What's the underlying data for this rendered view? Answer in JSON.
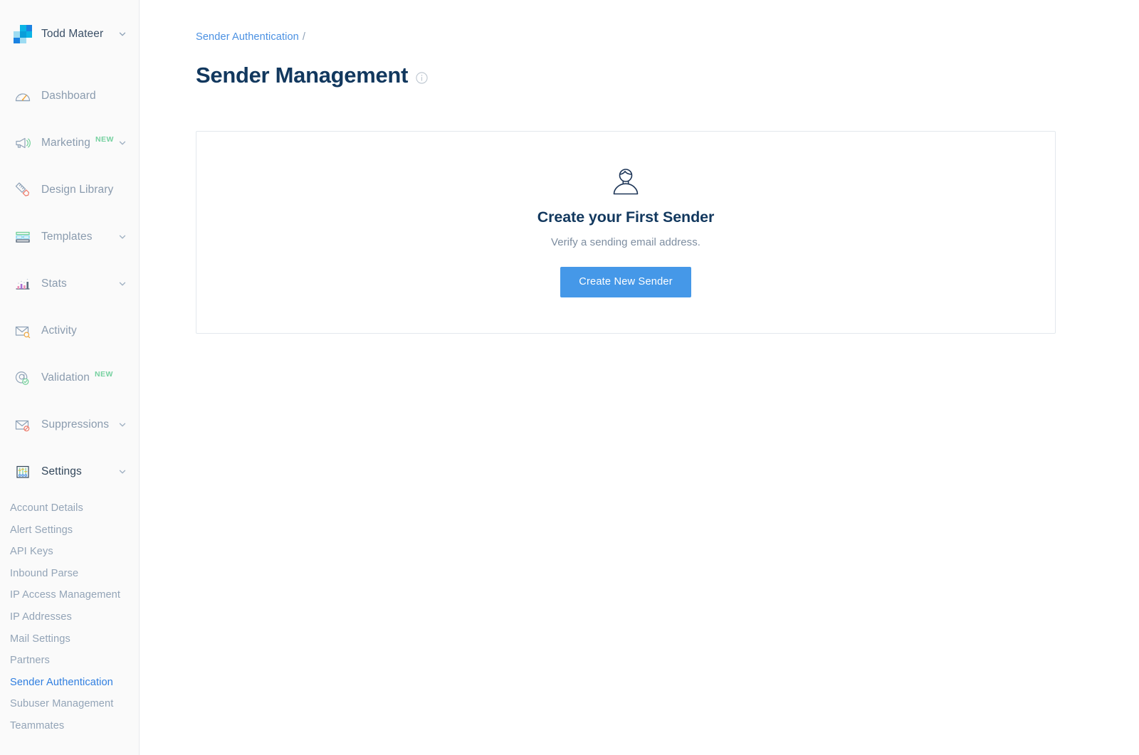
{
  "colors": {
    "accent_blue": "#4598e8",
    "link_blue": "#4a90e2",
    "active_link_blue": "#2f7ee0",
    "title_navy": "#12385e",
    "muted_text": "#8a9bae",
    "badge_green": "#76d1a0",
    "sidebar_bg": "#fafafa",
    "card_border": "#e3e8ed"
  },
  "sidebar": {
    "account": {
      "name": "Todd Mateer",
      "logo_icon": "sendgrid-logo-icon",
      "caret_icon": "chevron-down-icon"
    },
    "items": [
      {
        "label": "Dashboard",
        "icon": "speedometer-icon",
        "badge": "",
        "caret": false,
        "active": false
      },
      {
        "label": "Marketing",
        "icon": "megaphone-icon",
        "badge": "NEW",
        "caret": true,
        "active": false
      },
      {
        "label": "Design Library",
        "icon": "ruler-pencil-icon",
        "badge": "",
        "caret": false,
        "active": false
      },
      {
        "label": "Templates",
        "icon": "layout-template-icon",
        "badge": "",
        "caret": true,
        "active": false
      },
      {
        "label": "Stats",
        "icon": "bar-chart-icon",
        "badge": "",
        "caret": true,
        "active": false
      },
      {
        "label": "Activity",
        "icon": "envelope-search-icon",
        "badge": "",
        "caret": false,
        "active": false
      },
      {
        "label": "Validation",
        "icon": "at-check-icon",
        "badge": "NEW",
        "caret": false,
        "active": false
      },
      {
        "label": "Suppressions",
        "icon": "envelope-blocked-icon",
        "badge": "",
        "caret": true,
        "active": false
      },
      {
        "label": "Settings",
        "icon": "sliders-icon",
        "badge": "",
        "caret": true,
        "active": true
      }
    ],
    "settings_subitems": [
      {
        "label": "Account Details",
        "active": false
      },
      {
        "label": "Alert Settings",
        "active": false
      },
      {
        "label": "API Keys",
        "active": false
      },
      {
        "label": "Inbound Parse",
        "active": false
      },
      {
        "label": "IP Access Management",
        "active": false
      },
      {
        "label": "IP Addresses",
        "active": false
      },
      {
        "label": "Mail Settings",
        "active": false
      },
      {
        "label": "Partners",
        "active": false
      },
      {
        "label": "Sender Authentication",
        "active": true
      },
      {
        "label": "Subuser Management",
        "active": false
      },
      {
        "label": "Teammates",
        "active": false
      }
    ]
  },
  "main": {
    "breadcrumb": {
      "crumb": "Sender Authentication",
      "separator": "/"
    },
    "page_title": "Sender Management",
    "info_icon": "info-circle-icon",
    "empty_state": {
      "icon": "person-avatar-icon",
      "heading": "Create your First Sender",
      "subtitle": "Verify a sending email address.",
      "button_label": "Create New Sender"
    }
  }
}
